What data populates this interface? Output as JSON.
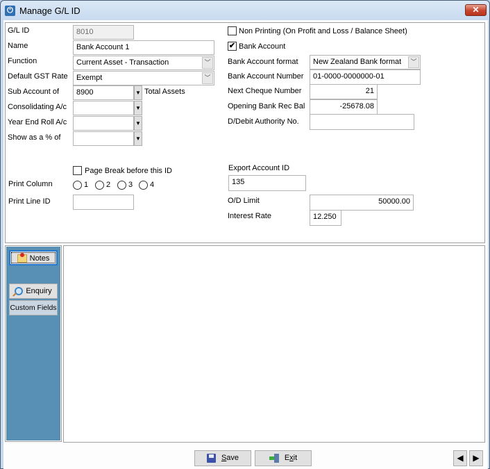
{
  "window": {
    "title": "Manage G/L ID",
    "app_icon": "power-icon",
    "close_icon": "close-icon"
  },
  "left_form": {
    "gl_id": {
      "label": "G/L ID",
      "value": "8010"
    },
    "name": {
      "label": "Name",
      "value": "Bank Account 1"
    },
    "function": {
      "label": "Function",
      "value": "Current Asset - Transaction"
    },
    "gst_rate": {
      "label": "Default GST Rate",
      "value": "Exempt"
    },
    "sub_account": {
      "label": "Sub Account of",
      "value": "8900",
      "description": "Total Assets"
    },
    "consolidating": {
      "label": "Consolidating A/c",
      "value": ""
    },
    "year_end_roll": {
      "label": "Year End Roll A/c",
      "value": ""
    },
    "show_as_pct": {
      "label": "Show as a % of",
      "value": ""
    },
    "page_break": {
      "label": "Page Break before this ID",
      "checked": false
    },
    "print_column": {
      "label": "Print Column",
      "options": [
        "1",
        "2",
        "3",
        "4"
      ],
      "selected": null
    },
    "print_line_id": {
      "label": "Print Line ID",
      "value": ""
    }
  },
  "right_form": {
    "non_printing": {
      "label": "Non Printing (On Profit and Loss / Balance Sheet)",
      "checked": false
    },
    "bank_account": {
      "label": "Bank Account",
      "checked": true,
      "check_glyph": "✔"
    },
    "bank_format": {
      "label": "Bank Account format",
      "value": "New Zealand Bank format"
    },
    "bank_number": {
      "label": "Bank Account Number",
      "value": "01-0000-0000000-01"
    },
    "next_cheque": {
      "label": "Next Cheque Number",
      "value": "21"
    },
    "opening_bal": {
      "label": "Opening Bank Rec Bal",
      "value": "-25678.08"
    },
    "ddebit": {
      "label": "D/Debit Authority No.",
      "value": ""
    },
    "export_id": {
      "label": "Export Account ID",
      "value": "135"
    },
    "od_limit": {
      "label": "O/D Limit",
      "value": "50000.00"
    },
    "interest_rate": {
      "label": "Interest Rate",
      "value": "12.250"
    }
  },
  "side_tabs": [
    {
      "label": "Notes",
      "icon": "notes-icon",
      "active": true
    },
    {
      "label": "Enquiry",
      "icon": "magnifier-icon",
      "active": false
    },
    {
      "label": "Custom Fields",
      "active": false
    }
  ],
  "notes": {
    "value": ""
  },
  "footer": {
    "save_prefix": "",
    "save_mnemonic": "S",
    "save_rest": "ave",
    "exit_prefix": "E",
    "exit_mnemonic": "x",
    "exit_rest": "it",
    "prev_glyph": "◀",
    "next_glyph": "▶"
  },
  "glyphs": {
    "combo_arrow": "﹀",
    "drop_arrow": "▼",
    "close": "✕"
  }
}
